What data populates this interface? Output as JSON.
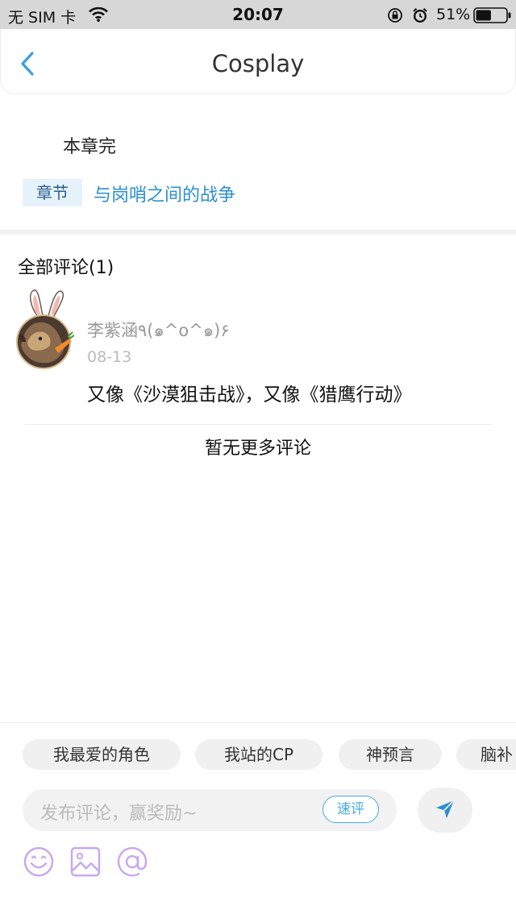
{
  "status_bar": {
    "carrier": "无 SIM 卡",
    "time": "20:07",
    "battery_percent": "51%",
    "battery_level": 0.51,
    "icons": [
      "wifi-icon",
      "orientation-lock-icon",
      "alarm-icon",
      "battery-icon"
    ]
  },
  "nav": {
    "title": "Cosplay",
    "back_icon": "chevron-left-icon"
  },
  "chapter": {
    "end_text": "本章完",
    "tag_label": "章节",
    "link_text": "与岗哨之间的战争"
  },
  "comments": {
    "header": "全部评论(1)",
    "items": [
      {
        "user": "李紫涵٩(๑^o^๑)۶",
        "date": "08-13",
        "text": "又像《沙漠狙击战》，又像《猎鹰行动》"
      }
    ],
    "no_more": "暂无更多评论"
  },
  "composer": {
    "chips": [
      "我最爱的角色",
      "我站的CP",
      "神预言",
      "脑补"
    ],
    "placeholder": "发布评论，赢奖励~",
    "quick_review": "速评",
    "send_icon": "send-icon",
    "tool_icons": [
      "emoji-icon",
      "image-icon",
      "mention-icon"
    ]
  },
  "colors": {
    "accent": "#2b8fd1",
    "quick_review": "#46a9e4",
    "tool_icon": "#c9a6ef",
    "tag_bg": "#e6f2fb"
  }
}
